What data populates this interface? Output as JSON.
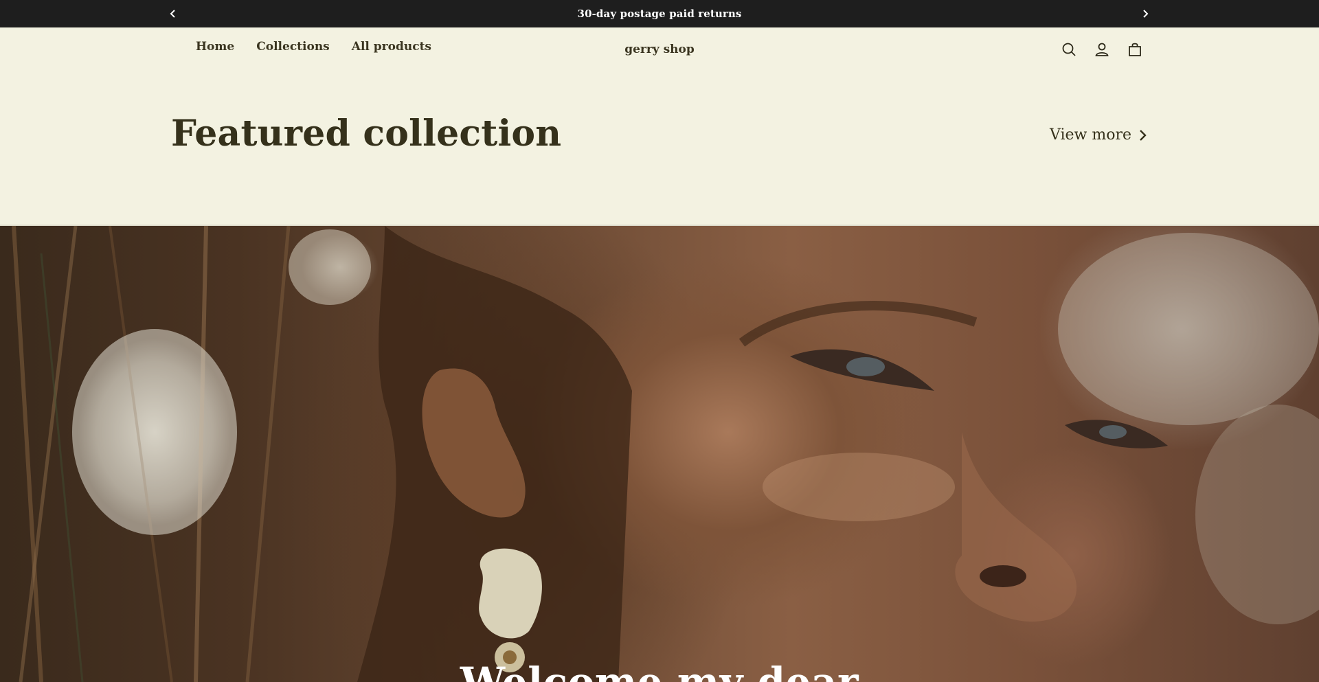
{
  "announcement": {
    "text": "30-day postage paid returns",
    "prev_icon": "chevron-left-icon",
    "next_icon": "chevron-right-icon"
  },
  "header": {
    "nav": [
      {
        "label": "Home"
      },
      {
        "label": "Collections"
      },
      {
        "label": "All products"
      }
    ],
    "brand": "gerry shop",
    "icons": [
      "search-icon",
      "account-icon",
      "cart-icon"
    ]
  },
  "featured": {
    "title": "Featured collection",
    "view_more": "View more"
  },
  "hero": {
    "heading": "Welcome my dear"
  },
  "colors": {
    "announce_bg": "#1e1e1e",
    "page_bg": "#f3f2e1",
    "text_dark": "#35311b"
  }
}
